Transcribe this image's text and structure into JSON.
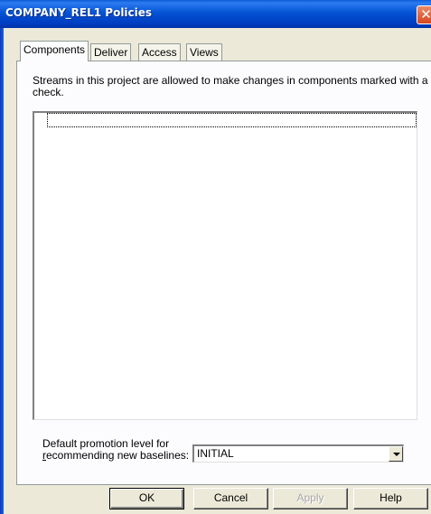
{
  "window": {
    "title": "COMPANY_REL1 Policies",
    "close_glyph": "✕"
  },
  "tabs": [
    {
      "label": "Components",
      "active": true
    },
    {
      "label": "Deliver",
      "active": false
    },
    {
      "label": "Access",
      "active": false
    },
    {
      "label": "Views",
      "active": false
    }
  ],
  "components": {
    "description": "Streams in this project are allowed to make changes in components marked with a check.",
    "items": []
  },
  "promotion": {
    "label_line1": "Default promotion level for",
    "label_line2_mnemonic": "r",
    "label_line2_rest": "ecommending new baselines:",
    "selected_value": "INITIAL"
  },
  "buttons": {
    "ok": "OK",
    "cancel": "Cancel",
    "apply": "Apply",
    "help": "Help"
  },
  "colors": {
    "titlebar": "#0453d4",
    "dialog_face": "#ece9d8",
    "close_button": "#d8461f"
  }
}
